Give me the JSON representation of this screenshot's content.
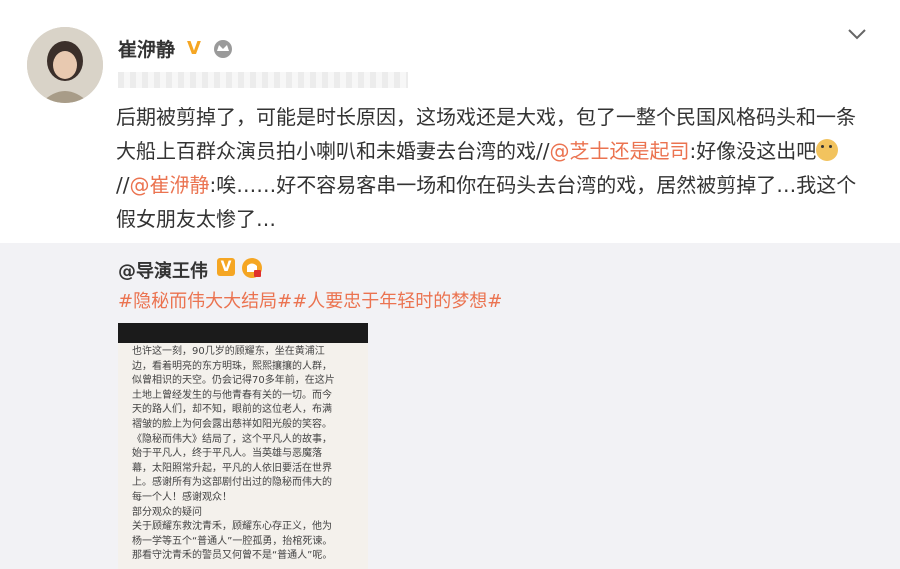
{
  "post": {
    "username": "崔洢静",
    "verified_badge": "V",
    "content_parts": [
      "后期被剪掉了，可能是时长原因，这场戏还是大戏，包了一整个民国风格码头和一条大船上百群众演员拍小喇叭和未婚妻去台湾的戏//",
      "@芝士还是起司",
      ":好像没这出吧",
      "//",
      "@崔洢静",
      ":唉……好不容易客串一场和你在码头去台湾的戏，居然被剪掉了…我这个假女朋友太惨了…"
    ],
    "emoji": "doge"
  },
  "repost": {
    "original_user": "@导演王伟",
    "verified_badge": "V",
    "hashtags": "#隐秘而伟大大结局##人要忠于年轻时的梦想#",
    "image_text_lines": [
      "也许这一刻，90几岁的顾耀东，坐在黄浦江",
      "边，看着明亮的东方明珠，熙熙攘攘的人群，",
      "似曾相识的天空。仍会记得70多年前，在这片",
      "土地上曾经发生的与他青春有关的一切。而今",
      "天的路人们，却不知，眼前的这位老人，布满",
      "褶皱的脸上为何会露出慈祥如阳光般的笑容。",
      "《隐秘而伟大》结局了，这个平凡人的故事，",
      "始于平凡人，终于平凡人。当英雄与恶魔落",
      "幕，太阳照常升起，平凡的人依旧要活在世界",
      "上。感谢所有为这部剧付出过的隐秘而伟大的",
      "每一个人！感谢观众！",
      "部分观众的疑问",
      "关于顾耀东救沈青禾，顾耀东心存正义，他为",
      "杨一学等五个“普通人”一腔孤勇，抬棺死谏。",
      "那看守沈青禾的警员又何曾不是“普通人”呢。"
    ]
  },
  "icons": {
    "crown": "crown-icon",
    "chevron": "chevron-down-icon",
    "fans": "fans-badge-icon"
  },
  "colors": {
    "mention": "#eb7350",
    "verified": "#f5a623",
    "repost_bg": "#f2f2f5"
  }
}
